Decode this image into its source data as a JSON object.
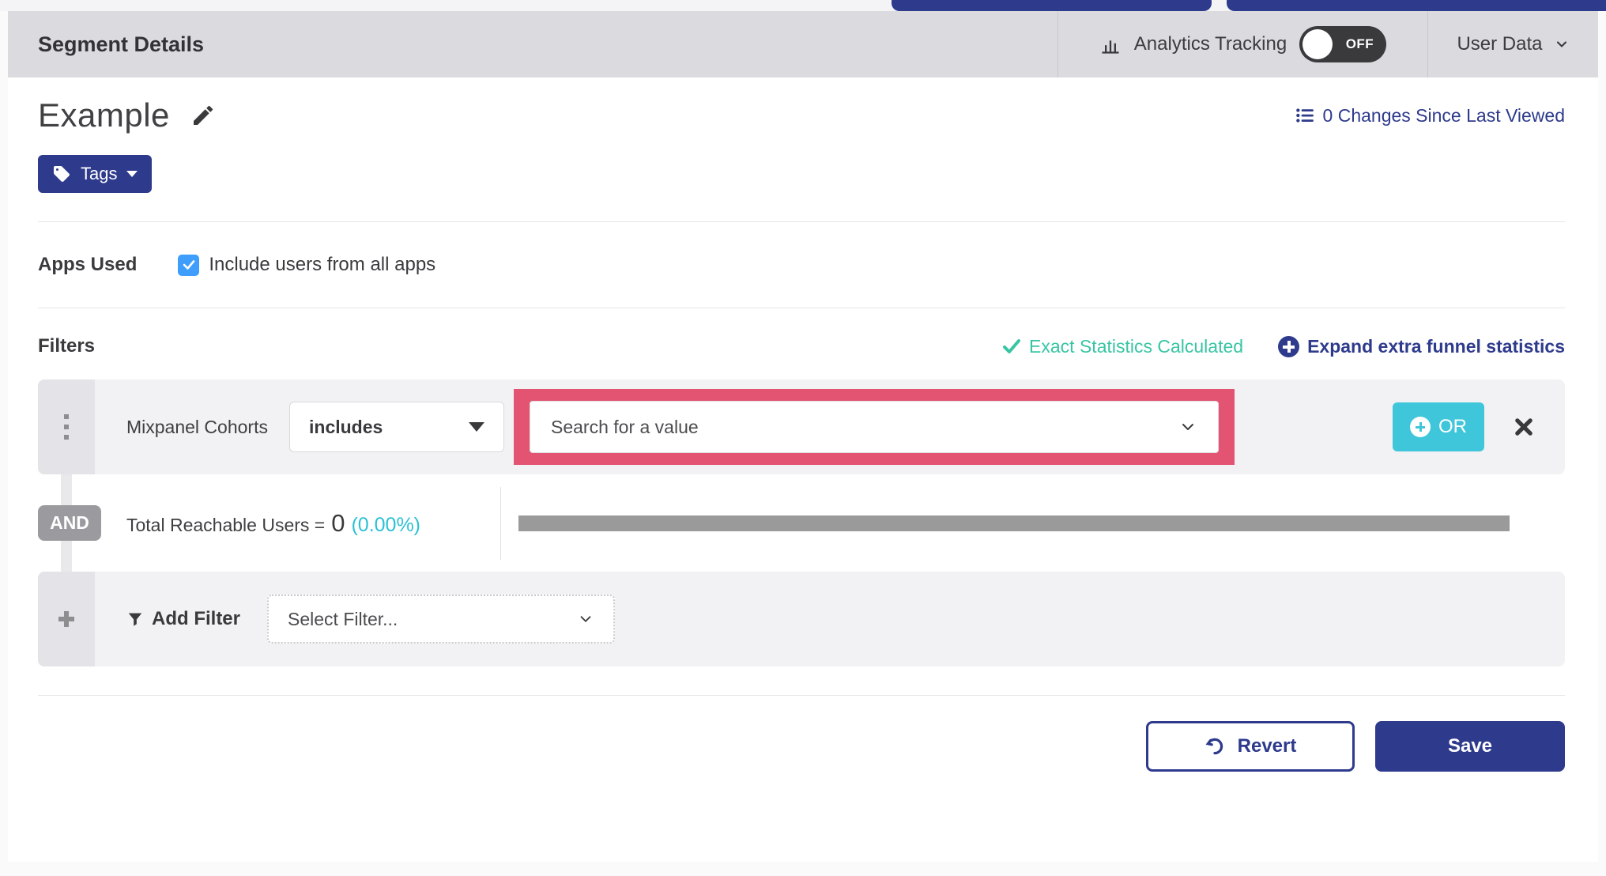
{
  "colors": {
    "indigo": "#2e3a8c",
    "or_cyan": "#3fc6da",
    "teal_status": "#38c5a4",
    "percent_cyan": "#2cc0d6",
    "highlight_pink": "#e25472",
    "checkbox_blue": "#3f9dfb",
    "toggle_dark": "#3a3a3c",
    "and_gray": "#9b9b9f",
    "progress_gray": "#9a9a9a",
    "header_gray": "#dbdbdf"
  },
  "icons": [
    "bar-chart-icon",
    "chevron-down-icon",
    "changes-list-icon",
    "pencil-icon",
    "tag-icon",
    "caret-down-icon",
    "check-icon",
    "plus-circle-icon",
    "drag-handle-icon",
    "close-icon",
    "funnel-icon",
    "plus-icon",
    "undo-icon",
    "checkbox-check-icon"
  ],
  "header": {
    "title": "Segment Details",
    "analytics_tracking_label": "Analytics Tracking",
    "toggle_state": "OFF",
    "user_data_label": "User Data"
  },
  "segment": {
    "name": "Example",
    "tags_button_label": "Tags",
    "changes_link": "0 Changes Since Last Viewed"
  },
  "apps_used": {
    "label": "Apps Used",
    "checkbox_label": "Include users from all apps",
    "checked": true
  },
  "filters": {
    "heading": "Filters",
    "status_text": "Exact Statistics Calculated",
    "expand_link": "Expand extra funnel statistics",
    "rows": [
      {
        "field": "Mixpanel Cohorts",
        "operator": "includes",
        "value_placeholder": "Search for a value",
        "or_button_label": "OR"
      }
    ],
    "conjunction": "AND",
    "reachable": {
      "label": "Total Reachable Users =",
      "value": "0",
      "percent": "(0.00%)",
      "progress_fraction": 0
    },
    "add_filter_label": "Add Filter",
    "select_filter_placeholder": "Select Filter..."
  },
  "footer": {
    "revert_label": "Revert",
    "save_label": "Save"
  }
}
